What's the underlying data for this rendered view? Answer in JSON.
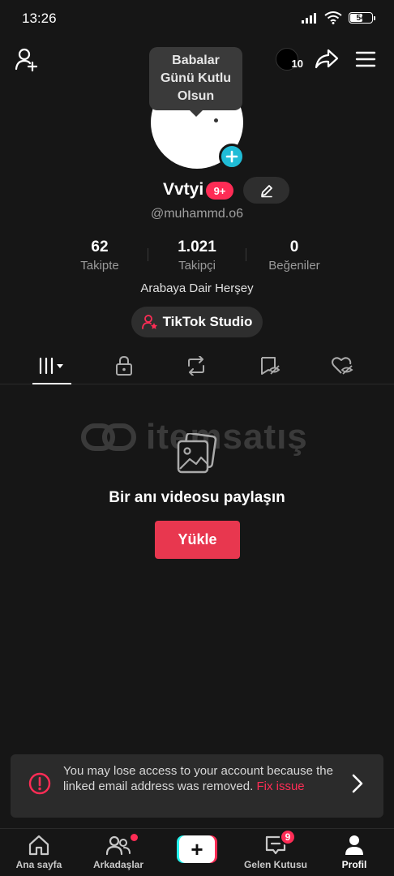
{
  "status_bar": {
    "time": "13:26",
    "battery": "54"
  },
  "topbar": {
    "story_count": "10"
  },
  "tooltip": {
    "text": "Babalar Günü Kutlu Olsun"
  },
  "profile": {
    "username": "Vvtyi",
    "notification_badge": "9+",
    "handle": "@muhammd.o6",
    "bio": "Arabaya Dair Herşey"
  },
  "stats": [
    {
      "value": "62",
      "label": "Takipte"
    },
    {
      "value": "1.021",
      "label": "Takipçi"
    },
    {
      "value": "0",
      "label": "Beğeniler"
    }
  ],
  "studio_button": {
    "label": "TikTok Studio"
  },
  "watermark": {
    "text": "itemsatış"
  },
  "empty_state": {
    "title": "Bir anı videosu paylaşın",
    "button": "Yükle"
  },
  "alert": {
    "message": "You may lose access to your account because the linked email address was removed. ",
    "link": "Fix issue"
  },
  "bottom_nav": {
    "home": "Ana sayfa",
    "friends": "Arkadaşlar",
    "inbox": "Gelen Kutusu",
    "inbox_badge": "9",
    "profile": "Profil"
  },
  "colors": {
    "accent": "#fe2c55",
    "cyan": "#25f4ee",
    "background": "#161616"
  }
}
